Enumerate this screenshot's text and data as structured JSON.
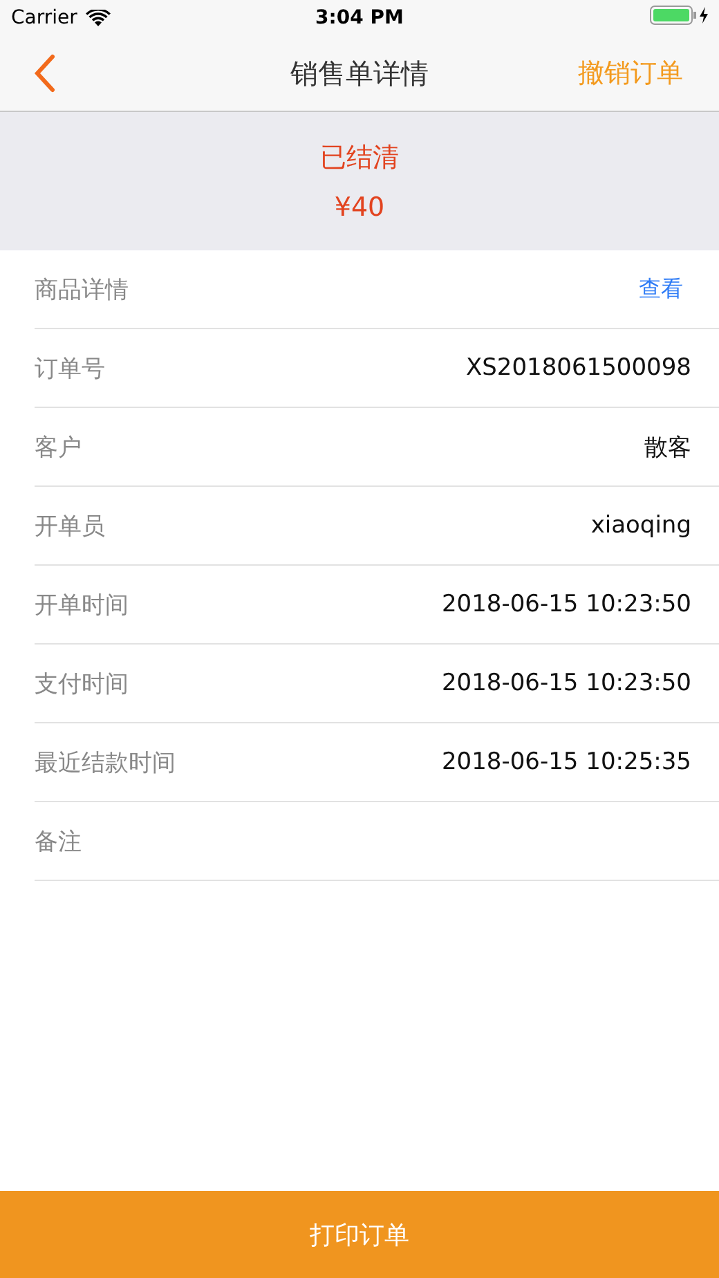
{
  "status_bar": {
    "carrier": "Carrier",
    "time": "3:04 PM"
  },
  "nav": {
    "title": "销售单详情",
    "action": "撤销订单"
  },
  "summary": {
    "status": "已结清",
    "amount": "¥40"
  },
  "rows": [
    {
      "kind": "link",
      "label": "商品详情",
      "value": "查看"
    },
    {
      "kind": "value",
      "label": "订单号",
      "value": "XS2018061500098"
    },
    {
      "kind": "value",
      "label": "客户",
      "value": "散客"
    },
    {
      "kind": "value",
      "label": "开单员",
      "value": "xiaoqing"
    },
    {
      "kind": "value",
      "label": "开单时间",
      "value": "2018-06-15 10:23:50"
    },
    {
      "kind": "value",
      "label": "支付时间",
      "value": "2018-06-15 10:23:50"
    },
    {
      "kind": "value",
      "label": "最近结款时间",
      "value": "2018-06-15 10:25:35"
    },
    {
      "kind": "empty",
      "label": "备注"
    }
  ],
  "footer_button": "打印订单"
}
